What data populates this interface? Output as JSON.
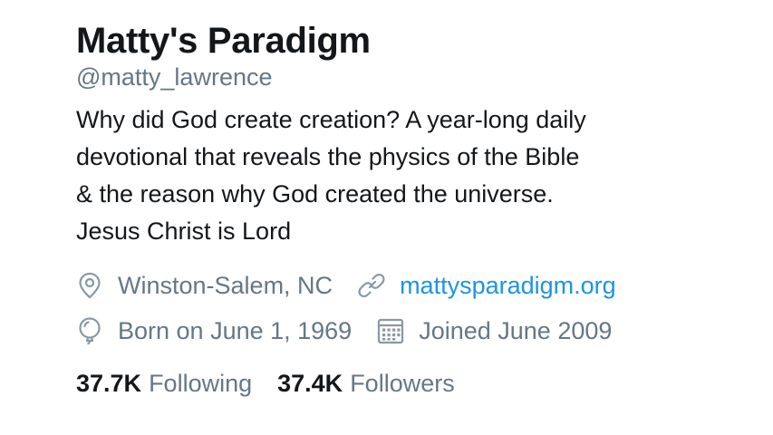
{
  "profile": {
    "display_name": "Matty's Paradigm",
    "handle": "@matty_lawrence",
    "bio_lines": [
      "Why did God create creation? A year-long daily",
      "devotional that reveals the physics of the Bible",
      "& the reason why God created the universe.",
      "Jesus Christ is Lord"
    ],
    "location": "Winston-Salem, NC",
    "website": "mattysparadigm.org",
    "birthday": "Born on June 1, 1969",
    "joined": "Joined June 2009",
    "following_count": "37.7K",
    "following_label": "Following",
    "followers_count": "37.4K",
    "followers_label": "Followers"
  },
  "icons": {
    "location": "map-pin-icon",
    "website": "link-icon",
    "birthday": "balloon-icon",
    "joined": "calendar-icon"
  },
  "colors": {
    "text": "#14171a",
    "secondary": "#657786",
    "link": "#1b95e0",
    "background": "#ffffff"
  }
}
